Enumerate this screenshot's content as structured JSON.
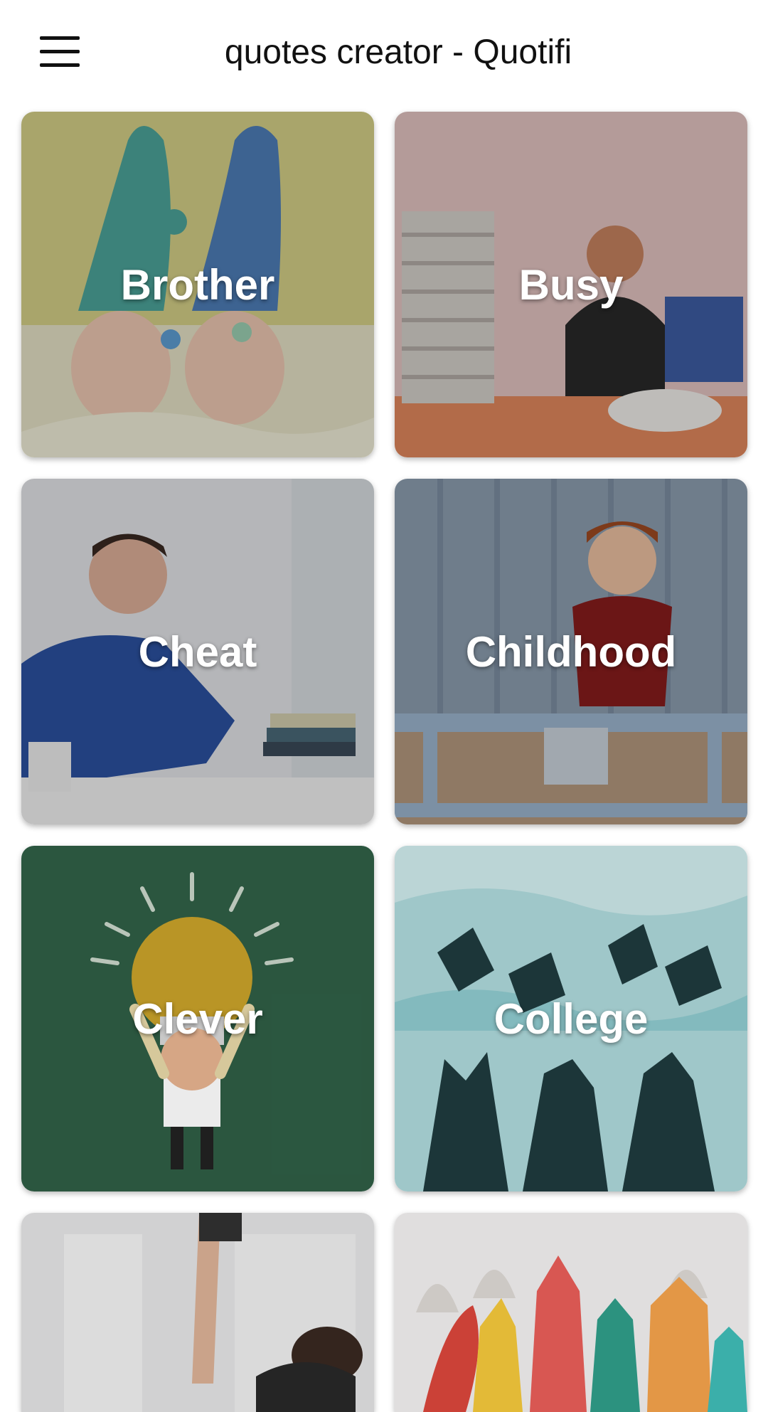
{
  "app_bar": {
    "title": "quotes creator - Quotifi",
    "menu_icon": "hamburger-menu-icon"
  },
  "categories": [
    {
      "label": "Brother",
      "image": "twin-babies-in-knit-hats"
    },
    {
      "label": "Busy",
      "image": "woman-buried-in-paperwork"
    },
    {
      "label": "Cheat",
      "image": "man-writing-at-desk"
    },
    {
      "label": "Childhood",
      "image": "laughing-boy-on-toy-plane"
    },
    {
      "label": "Clever",
      "image": "lightbulb-cartoon-character"
    },
    {
      "label": "College",
      "image": "graduation-caps-toss"
    },
    {
      "label": "",
      "image": "person-holding-phone-up"
    },
    {
      "label": "",
      "image": "cartoon-pencils-and-crayons"
    }
  ],
  "colors": {
    "background": "#ffffff",
    "title_text": "#111111",
    "card_label": "#ffffff",
    "clever_card": "#2f5e45",
    "college_card": "#9fcfd2"
  }
}
